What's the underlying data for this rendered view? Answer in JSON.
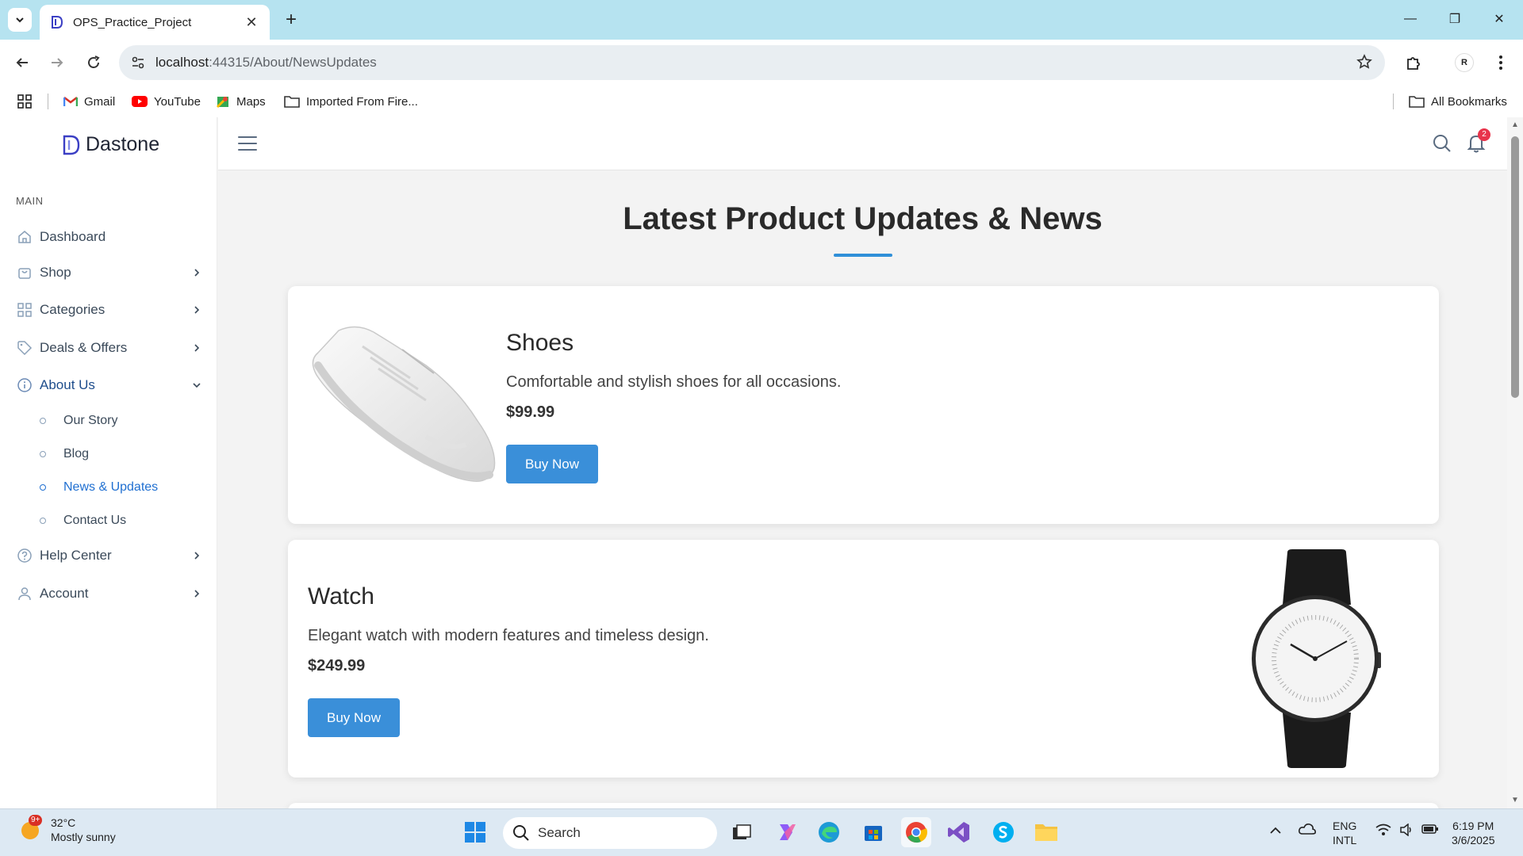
{
  "browser": {
    "tab_title": "OPS_Practice_Project",
    "url_host": "localhost",
    "url_path": ":44315/About/NewsUpdates",
    "profile_initial": "R",
    "bookmarks": [
      {
        "label": "Gmail",
        "icon": "gmail-icon"
      },
      {
        "label": "YouTube",
        "icon": "youtube-icon"
      },
      {
        "label": "Maps",
        "icon": "maps-icon"
      },
      {
        "label": "Imported From Fire...",
        "icon": "folder-icon"
      }
    ],
    "all_bookmarks": "All Bookmarks"
  },
  "app": {
    "brand": "Dastone",
    "section_label": "MAIN",
    "notification_count": "2",
    "nav": [
      {
        "label": "Dashboard",
        "icon": "home-icon",
        "has_chevron": false
      },
      {
        "label": "Shop",
        "icon": "shop-icon",
        "has_chevron": true
      },
      {
        "label": "Categories",
        "icon": "grid-icon",
        "has_chevron": true
      },
      {
        "label": "Deals & Offers",
        "icon": "tag-icon",
        "has_chevron": true
      },
      {
        "label": "About Us",
        "icon": "info-icon",
        "has_chevron": true,
        "expanded": true
      },
      {
        "label": "Help Center",
        "icon": "help-icon",
        "has_chevron": true
      },
      {
        "label": "Account",
        "icon": "user-icon",
        "has_chevron": true
      }
    ],
    "about_sub": [
      {
        "label": "Our Story"
      },
      {
        "label": "Blog"
      },
      {
        "label": "News & Updates",
        "current": true
      },
      {
        "label": "Contact Us"
      }
    ]
  },
  "main": {
    "title": "Latest Product Updates & News",
    "products": [
      {
        "name": "Shoes",
        "description": "Comfortable and stylish shoes for all occasions.",
        "price": "$99.99",
        "button": "Buy Now",
        "image": "sneaker-image"
      },
      {
        "name": "Watch",
        "description": "Elegant watch with modern features and timeless design.",
        "price": "$249.99",
        "button": "Buy Now",
        "image": "watch-image"
      }
    ]
  },
  "taskbar": {
    "weather_badge": "9+",
    "temperature": "32°C",
    "condition": "Mostly sunny",
    "search_placeholder": "Search",
    "lang_top": "ENG",
    "lang_bottom": "INTL",
    "time": "6:19 PM",
    "date": "3/6/2025"
  },
  "colors": {
    "accent": "#3a8fd9",
    "tabstrip": "#b6e3f0",
    "active_link": "#1f6fd1",
    "badge": "#e8344b"
  }
}
